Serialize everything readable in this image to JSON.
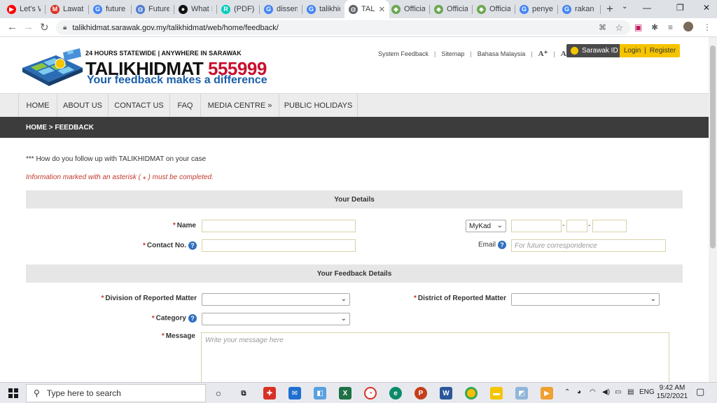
{
  "browser": {
    "tabs": [
      {
        "title": "Let's W",
        "favicon": "youtube-icon",
        "color": "#ff0000",
        "glyph": "▶"
      },
      {
        "title": "Lawatan",
        "favicon": "gmail-icon",
        "color": "#d93025",
        "glyph": "M"
      },
      {
        "title": "future l",
        "favicon": "google-icon",
        "color": "#4285f4",
        "glyph": "G"
      },
      {
        "title": "Futures",
        "favicon": "globe-icon",
        "color": "#4a7bd0",
        "glyph": "◍"
      },
      {
        "title": "What Is",
        "favicon": "medium-icon",
        "color": "#111111",
        "glyph": "●"
      },
      {
        "title": "(PDF) Fu",
        "favicon": "researchgate-icon",
        "color": "#00ccbb",
        "glyph": "R"
      },
      {
        "title": "dissem",
        "favicon": "google-icon",
        "color": "#4285f4",
        "glyph": "G"
      },
      {
        "title": "talikhid",
        "favicon": "google-icon",
        "color": "#4285f4",
        "glyph": "G"
      },
      {
        "title": "TAL",
        "favicon": "globe-icon",
        "color": "#5f6368",
        "glyph": "◍"
      },
      {
        "title": "Official",
        "favicon": "site-icon",
        "color": "#6aa84f",
        "glyph": "◆"
      },
      {
        "title": "Official",
        "favicon": "site-icon",
        "color": "#6aa84f",
        "glyph": "◆"
      },
      {
        "title": "Official",
        "favicon": "site-icon",
        "color": "#6aa84f",
        "glyph": "◆"
      },
      {
        "title": "penyele",
        "favicon": "google-icon",
        "color": "#4285f4",
        "glyph": "G"
      },
      {
        "title": "rakan s",
        "favicon": "google-icon",
        "color": "#4285f4",
        "glyph": "G"
      }
    ],
    "url": "talikhidmat.sarawak.gov.my/talikhidmat/web/home/feedback/"
  },
  "header": {
    "tagline": "24 HOURS STATEWIDE  |  ANYWHERE IN SARAWAK",
    "brand": "TALIKHIDMAT",
    "brand_number": "555999",
    "slogan": "Your feedback makes a difference",
    "links": [
      "System Feedback",
      "Sitemap",
      "Bahasa Malaysia"
    ],
    "font_up": "A⁺",
    "font_down": "A⁻",
    "sarawak_id": "Sarawak ID",
    "login": "Login",
    "register": "Register"
  },
  "nav": {
    "items": [
      "HOME",
      "ABOUT US",
      "CONTACT US",
      "FAQ",
      "MEDIA CENTRE  »",
      "PUBLIC HOLIDAYS"
    ]
  },
  "breadcrumb": "HOME > FEEDBACK",
  "intro": "*** How do you follow up with TALIKHIDMAT on your case",
  "required_note": "Information marked with an asterisk ( ⁎ ) must be completed.",
  "form": {
    "section_details": "Your Details",
    "name_label": "Name",
    "contact_label": "Contact No.",
    "id_type": "MyKad",
    "email_label": "Email",
    "email_placeholder": "For future correspondence",
    "section_feedback": "Your Feedback Details",
    "division_label": "Division of Reported Matter",
    "district_label": "District of Reported Matter",
    "category_label": "Category",
    "message_label": "Message",
    "message_placeholder": "Write your message here"
  },
  "taskbar": {
    "search_placeholder": "Type here to search",
    "language": "ENG",
    "time": "9:42 AM",
    "date": "15/2/2021"
  }
}
